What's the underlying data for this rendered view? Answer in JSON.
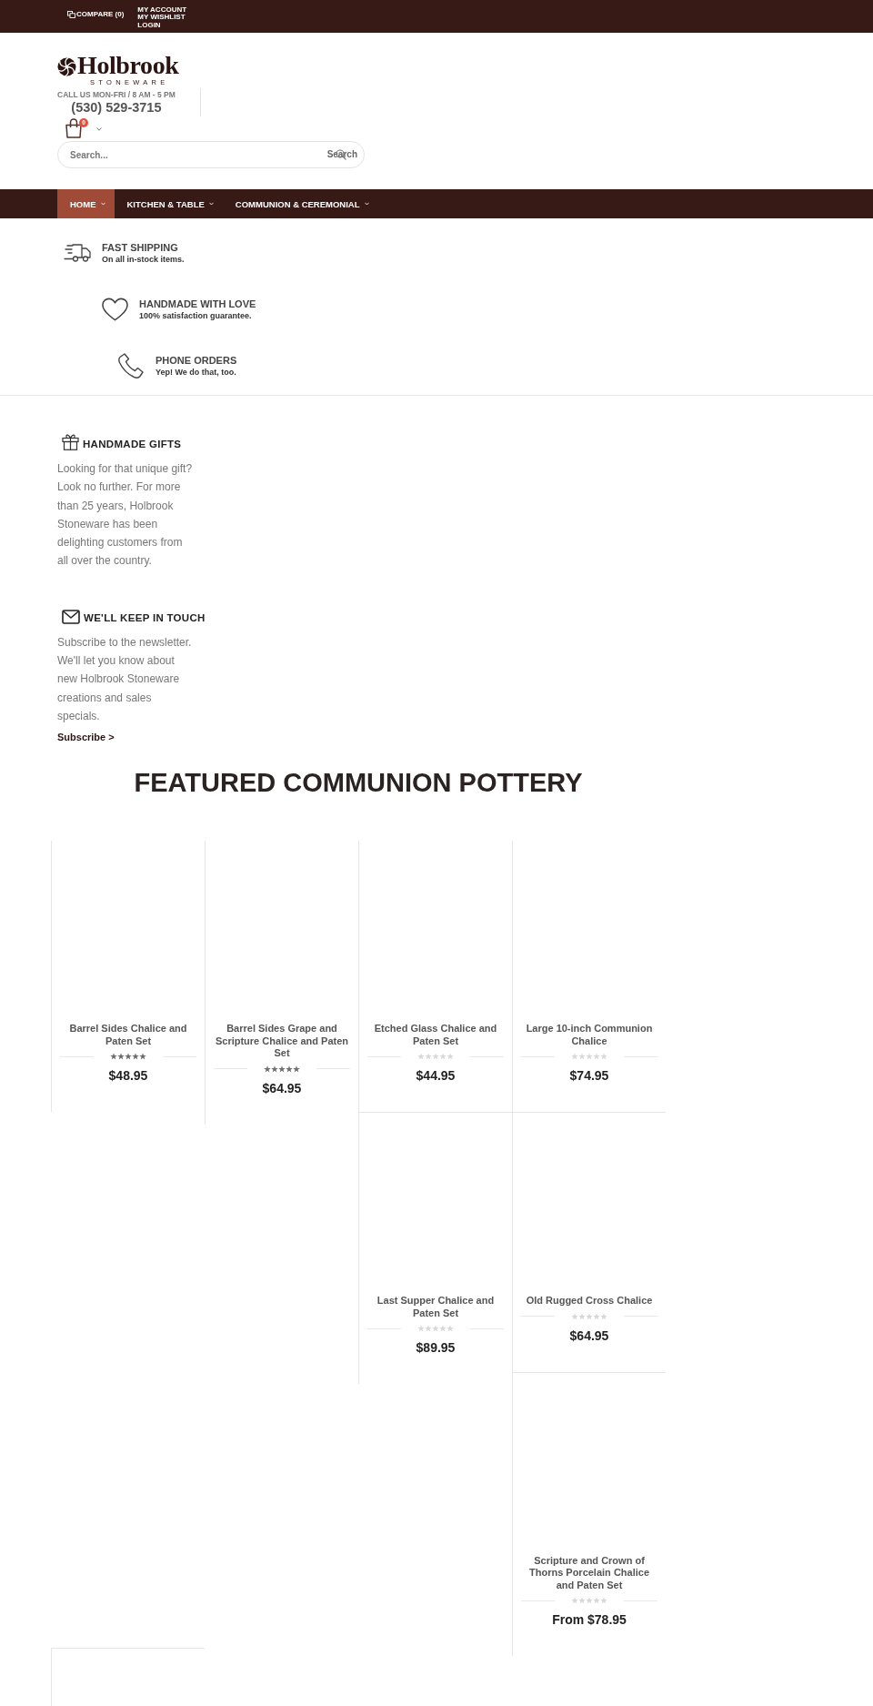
{
  "top_bar": {
    "compare": "COMPARE (0)",
    "account_links": [
      "MY ACCOUNT",
      "MY WISHLIST",
      "LOGIN"
    ]
  },
  "header": {
    "logo": {
      "name": "Holbrook",
      "tagline": "STONEWARE"
    },
    "call_hours": "CALL US MON-FRI / 8 AM - 5 PM",
    "phone": "(530) 529-3715",
    "cart_count": "0",
    "search": {
      "placeholder": "Search...",
      "button": "Search"
    }
  },
  "nav": [
    {
      "label": "HOME",
      "selected": true
    },
    {
      "label": "KITCHEN & TABLE",
      "selected": false
    },
    {
      "label": "COMMUNION & CEREMONIAL",
      "selected": false
    }
  ],
  "features": [
    {
      "kind": "shipping",
      "title": "FAST SHIPPING",
      "subtitle": "On all in-stock items."
    },
    {
      "kind": "love",
      "title": "HANDMADE WITH LOVE",
      "subtitle": "100% satisfaction guarantee."
    },
    {
      "kind": "phone",
      "title": "PHONE ORDERS",
      "subtitle": "Yep! We do that, too."
    }
  ],
  "info_blocks": [
    {
      "kind": "gift",
      "title": "HANDMADE GIFTS",
      "text": "Looking for that unique gift? Look no further. For more than 25 years, Holbrook Stoneware has been delighting customers from all over the country."
    },
    {
      "kind": "mail",
      "title": "WE'LL KEEP IN TOUCH",
      "text": "Subscribe to the newsletter. We'll let you know about new Holbrook Stoneware creations and sales specials.",
      "link": "Subscribe >"
    }
  ],
  "featured": {
    "title": "FEATURED COMMUNION POTTERY",
    "products": [
      {
        "name": "Barrel Sides Chalice and Paten Set",
        "stars": 5,
        "price": "$48.95"
      },
      {
        "name": "Barrel Sides Grape and Scripture Chalice and Paten Set",
        "stars": 5,
        "price": "$64.95"
      },
      {
        "name": "Etched Glass Chalice and Paten Set",
        "stars": 0,
        "price": "$44.95"
      },
      {
        "name": "Large 10-inch Communion Chalice",
        "stars": 0,
        "price": "$74.95"
      },
      {
        "name": "Last Supper Chalice and Paten Set",
        "stars": 0,
        "price": "$89.95"
      },
      {
        "name": "Old Rugged Cross Chalice",
        "stars": 0,
        "price": "$64.95"
      },
      {
        "name": "Scripture and Crown of Thorns Porcelain Chalice and Paten Set",
        "stars": 0,
        "price": "From $78.95"
      }
    ]
  }
}
